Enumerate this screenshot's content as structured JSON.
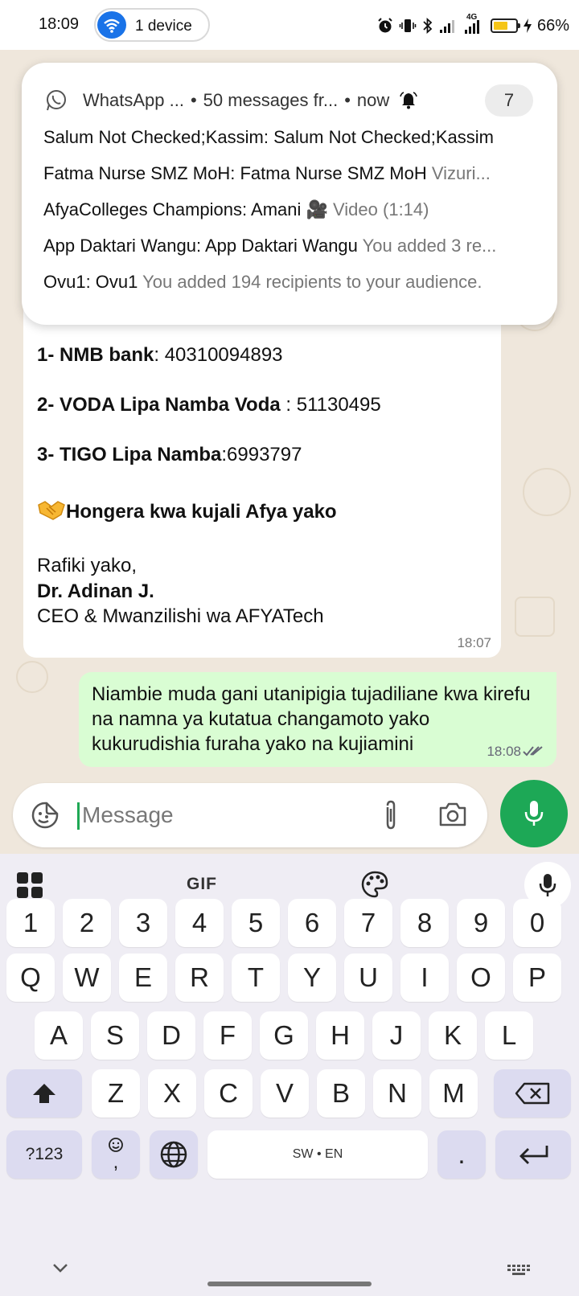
{
  "status_bar": {
    "time": "18:09",
    "device_label": "1 device",
    "network_type": "4G",
    "battery_percent": "66%",
    "battery_level": 0.66,
    "icons": [
      "alarm-icon",
      "vibrate-icon",
      "bluetooth-icon",
      "signal-icon",
      "signal-4g-icon",
      "battery-icon",
      "charging-icon"
    ]
  },
  "notification": {
    "app_name": "WhatsApp ...",
    "summary": "50 messages fr...",
    "when": "now",
    "count": "7",
    "lines": [
      {
        "sender": "Salum Not Checked;Kassim: Salum Not Checked;Kassim",
        "message": ""
      },
      {
        "sender": "Fatma Nurse SMZ MoH: Fatma Nurse SMZ MoH",
        "message": "Vizuri..."
      },
      {
        "sender": "AfyaColleges Champions: Amani",
        "message": "🎥 Video (1:14)"
      },
      {
        "sender": "App Daktari Wangu: App Daktari Wangu",
        "message": "You added 3 re..."
      },
      {
        "sender": "Ovu1: Ovu1",
        "message": "You added 194 recipients to your audience."
      }
    ]
  },
  "incoming_message": {
    "line1_bold": "1- NMB bank",
    "line1_rest": ": 40310094893",
    "line2_bold": "2- VODA Lipa Namba Voda",
    "line2_rest": " : 51130495",
    "line3_bold": "3- TIGO Lipa Namba",
    "line3_rest": ":6993797",
    "congrats": "Hongera kwa kujali Afya yako",
    "closing": "Rafiki yako,",
    "signature_name": "Dr. Adinan J.",
    "signature_title": "CEO & Mwanzilishi wa AFYATech",
    "time": "18:07"
  },
  "outgoing_message": {
    "text": "Niambie muda gani utanipigia tujadiliane kwa kirefu na namna ya kutatua changamoto yako kukurudishia furaha yako na kujiamini",
    "time": "18:08"
  },
  "composer": {
    "placeholder": "Message",
    "value": ""
  },
  "keyboard": {
    "gif_label": "GIF",
    "number_row": [
      "1",
      "2",
      "3",
      "4",
      "5",
      "6",
      "7",
      "8",
      "9",
      "0"
    ],
    "row1": [
      "Q",
      "W",
      "E",
      "R",
      "T",
      "Y",
      "U",
      "I",
      "O",
      "P"
    ],
    "row2": [
      "A",
      "S",
      "D",
      "F",
      "G",
      "H",
      "J",
      "K",
      "L"
    ],
    "row3": [
      "Z",
      "X",
      "C",
      "V",
      "B",
      "N",
      "M"
    ],
    "symbols_label": "?123",
    "emoji_comma_label": ",",
    "space_label": "SW • EN",
    "period_label": "."
  },
  "colors": {
    "whatsapp_green": "#1da856",
    "outgoing_bubble": "#d9fdd3",
    "chat_background": "#efe7dc",
    "keyboard_background": "#efedf4",
    "dark_key": "#dcdbf0",
    "accent_blue": "#1a73e8"
  }
}
